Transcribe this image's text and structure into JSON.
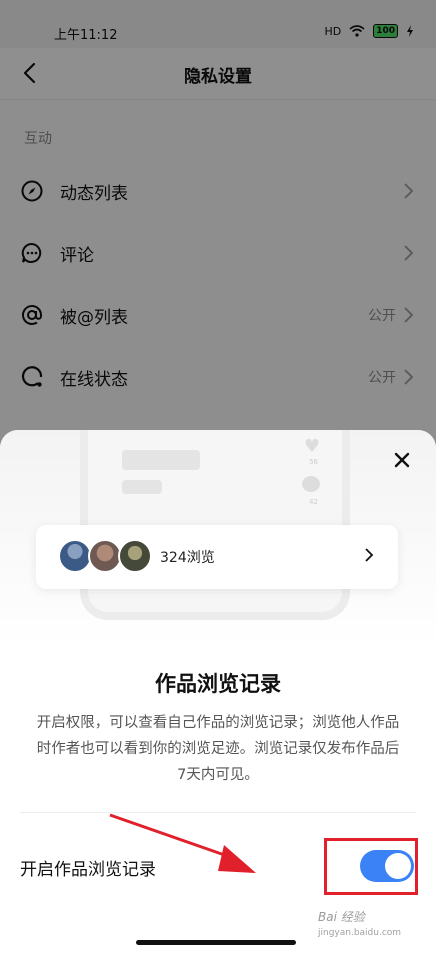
{
  "status_bar": {
    "time": "上午11:12",
    "signal": "HD",
    "battery": "100"
  },
  "nav": {
    "title": "隐私设置"
  },
  "section": {
    "label": "互动"
  },
  "rows": [
    {
      "label": "动态列表",
      "value": ""
    },
    {
      "label": "评论",
      "value": ""
    },
    {
      "label": "被@列表",
      "value": "公开"
    },
    {
      "label": "在线状态",
      "value": "公开"
    }
  ],
  "sheet": {
    "illustration": {
      "likes": "56",
      "comments": "42"
    },
    "views_card": {
      "text": "324浏览"
    },
    "title": "作品浏览记录",
    "description": "开启权限，可以查看自己作品的浏览记录；浏览他人作品时作者也可以看到你的浏览足迹。浏览记录仅发布作品后7天内可见。",
    "toggle_label": "开启作品浏览记录",
    "toggle_on": true
  },
  "watermark": {
    "line1": "Bai 经验",
    "line2": "jingyan.baidu.com"
  },
  "colors": {
    "toggle_on": "#3b82f6",
    "highlight_box": "#e0202a"
  }
}
